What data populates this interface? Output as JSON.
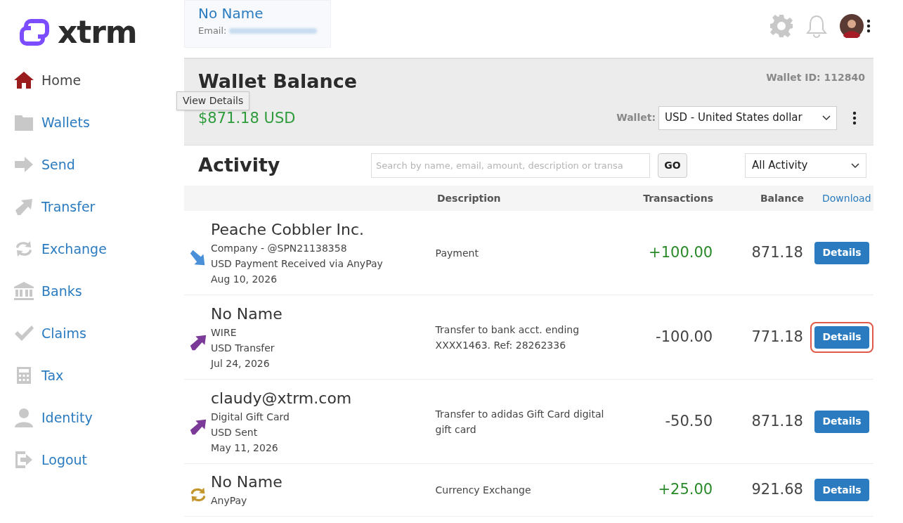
{
  "logo": {
    "text": "xtrm"
  },
  "sidebar": {
    "items": [
      {
        "label": "Home",
        "kind": "home",
        "selected": true
      },
      {
        "label": "Wallets",
        "kind": "folder",
        "selected": false
      },
      {
        "label": "Send",
        "kind": "send",
        "selected": false
      },
      {
        "label": "Transfer",
        "kind": "transfer",
        "selected": false
      },
      {
        "label": "Exchange",
        "kind": "exchange",
        "selected": false
      },
      {
        "label": "Banks",
        "kind": "bank",
        "selected": false
      },
      {
        "label": "Claims",
        "kind": "check",
        "selected": false
      },
      {
        "label": "Tax",
        "kind": "calculator",
        "selected": false
      },
      {
        "label": "Identity",
        "kind": "person",
        "selected": false
      },
      {
        "label": "Logout",
        "kind": "logout",
        "selected": false
      }
    ]
  },
  "profile": {
    "name": "No Name",
    "email_label": "Email:"
  },
  "wallet": {
    "title": "Wallet Balance",
    "wallet_id": "Wallet ID: 112840",
    "balance": "$871.18 USD",
    "wallet_label": "Wallet:",
    "wallet_select": "USD - United States dollar",
    "tooltip": "View Details"
  },
  "activity": {
    "title": "Activity",
    "search_placeholder": "Search by name, email, amount, description or transa",
    "go": "GO",
    "filter": "All Activity"
  },
  "table": {
    "columns": [
      "Description",
      "Transactions",
      "Balance"
    ],
    "download": "Download",
    "rows": [
      {
        "kind": "incoming",
        "name": "Peache Cobbler Inc.",
        "details": [
          "Company - @SPN21138358",
          "USD Payment Received via AnyPay",
          "Aug 10, 2026"
        ],
        "description": "Payment",
        "amount": "+100.00",
        "credit": true,
        "balance": "871.18",
        "button": "Details",
        "highlighted": false
      },
      {
        "kind": "transfer",
        "name": "No Name",
        "details": [
          "WIRE",
          "USD Transfer",
          "Jul 24, 2026"
        ],
        "description": "Transfer to bank acct. ending XXXX1463. Ref: 28262336",
        "amount": "-100.00",
        "credit": false,
        "balance": "771.18",
        "button": "Details",
        "highlighted": true
      },
      {
        "kind": "transfer",
        "name": "claudy@xtrm.com",
        "details": [
          "Digital Gift Card",
          "USD Sent",
          "May 11, 2026"
        ],
        "description": "Transfer to adidas Gift Card digital gift card",
        "amount": "-50.50",
        "credit": false,
        "balance": "871.18",
        "button": "Details",
        "highlighted": false
      },
      {
        "kind": "exchange",
        "name": "No Name",
        "details": [
          "AnyPay"
        ],
        "description": "Currency Exchange",
        "amount": "+25.00",
        "credit": true,
        "balance": "921.68",
        "button": "Details",
        "highlighted": false
      }
    ]
  }
}
